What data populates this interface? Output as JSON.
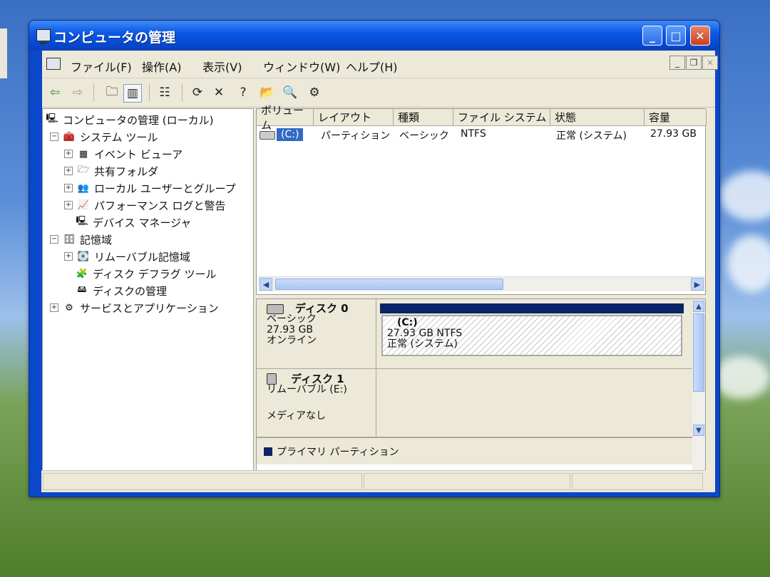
{
  "window": {
    "title": "コンピュータの管理"
  },
  "menu": {
    "items": [
      "ファイル(F)",
      "操作(A)",
      "表示(V)",
      "ウィンドウ(W)",
      "ヘルプ(H)"
    ]
  },
  "toolbar": {
    "icons": [
      "back-arrow-icon",
      "forward-arrow-icon",
      "up-folder-icon",
      "show-tree-icon",
      "properties-icon",
      "refresh-icon",
      "delete-icon",
      "help-icon",
      "open-folder-icon",
      "search-icon",
      "wizard-icon"
    ]
  },
  "tree": {
    "root": "コンピュータの管理 (ローカル)",
    "system_tools": "システム ツール",
    "event_viewer": "イベント ビューア",
    "shared_folders": "共有フォルダ",
    "local_users": "ローカル ユーザーとグループ",
    "perf_logs": "パフォーマンス ログと警告",
    "device_manager": "デバイス マネージャ",
    "storage": "記憶域",
    "removable_storage": "リムーバブル記憶域",
    "defrag": "ディスク デフラグ ツール",
    "disk_mgmt": "ディスクの管理",
    "services_apps": "サービスとアプリケーション"
  },
  "volumes": {
    "columns": [
      "ボリューム",
      "レイアウト",
      "種類",
      "ファイル システム",
      "状態",
      "容量"
    ],
    "rows": [
      {
        "volume": "(C:)",
        "layout": "パーティション",
        "type": "ベーシック",
        "fs": "NTFS",
        "status": "正常 (システム)",
        "capacity": "27.93 GB"
      }
    ]
  },
  "disks": [
    {
      "name": "ディスク 0",
      "type": "ベーシック",
      "size": "27.93 GB",
      "state": "オンライン",
      "partition": {
        "label": "(C:)",
        "size_fs": "27.93 GB NTFS",
        "status": "正常 (システム)"
      }
    },
    {
      "name": "ディスク 1",
      "type": "リムーバブル (E:)",
      "state": "メディアなし"
    }
  ],
  "legend": {
    "primary": "プライマリ パーティション"
  },
  "colors": {
    "titlebar": "#0b59e6",
    "selection": "#316ac5",
    "primary_partition": "#0a2467"
  }
}
